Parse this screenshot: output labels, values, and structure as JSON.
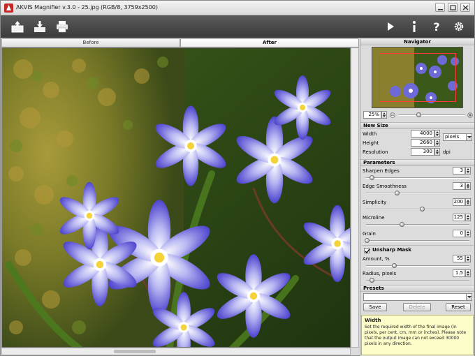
{
  "window": {
    "title": "AKVIS Magnifier v.3.0 - 25.jpg (RGB/8, 3759x2500)"
  },
  "toolbar": {
    "icons": [
      "open-file-icon",
      "save-file-icon",
      "print-icon",
      "run-icon",
      "info-icon",
      "help-icon",
      "settings-icon"
    ]
  },
  "tabs": [
    {
      "label": "Before"
    },
    {
      "label": "After"
    }
  ],
  "navigator": {
    "title": "Navigator",
    "zoom": "25%"
  },
  "new_size": {
    "title": "New Size",
    "width_label": "Width",
    "width_value": "4000",
    "height_label": "Height",
    "height_value": "2660",
    "units": "pixels",
    "resolution_label": "Resolution",
    "resolution_value": "300",
    "resolution_unit": "dpi"
  },
  "parameters": {
    "title": "Parameters",
    "items": [
      {
        "label": "Sharpen Edges",
        "value": "3",
        "level": 0.05
      },
      {
        "label": "Edge Smoothness",
        "value": "3",
        "level": 0.3
      },
      {
        "label": "Simplicity",
        "value": "200",
        "level": 0.55
      },
      {
        "label": "Microline",
        "value": "125",
        "level": 0.35
      },
      {
        "label": "Grain",
        "value": "0",
        "level": 0.0
      }
    ]
  },
  "unsharp_mask": {
    "label": "Unsharp Mask",
    "checked": true,
    "items": [
      {
        "label": "Amount, %",
        "value": "55",
        "level": 0.27
      },
      {
        "label": "Radius, pixels",
        "value": "1.5",
        "level": 0.05
      }
    ]
  },
  "presets": {
    "title": "Presets",
    "save_label": "Save",
    "delete_label": "Delete",
    "reset_label": "Reset"
  },
  "help": {
    "title": "Width",
    "text": "Set the required width of the final image (in pixels, per cent, cm, mm or inches). Please note that the output image can not exceed 30000 pixels in any direction."
  },
  "colors": {
    "toolbar_bg": "#4a4a4a",
    "help_bg": "#fdfdc9",
    "navigator_frame": "#ff3a3a"
  }
}
